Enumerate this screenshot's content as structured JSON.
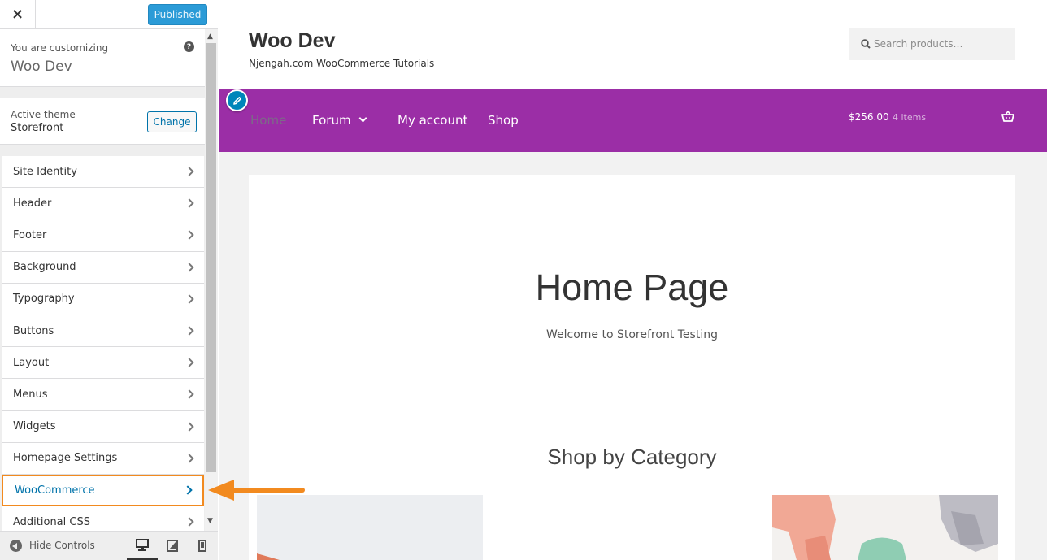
{
  "sidebar": {
    "close_label": "×",
    "publish_label": "Published",
    "info_label": "You are customizing",
    "site_name": "Woo Dev",
    "help_label": "?",
    "theme_label": "Active theme",
    "theme_name": "Storefront",
    "change_label": "Change",
    "items": [
      {
        "label": "Site Identity"
      },
      {
        "label": "Header"
      },
      {
        "label": "Footer"
      },
      {
        "label": "Background"
      },
      {
        "label": "Typography"
      },
      {
        "label": "Buttons"
      },
      {
        "label": "Layout"
      },
      {
        "label": "Menus"
      },
      {
        "label": "Widgets"
      },
      {
        "label": "Homepage Settings"
      },
      {
        "label": "WooCommerce"
      },
      {
        "label": "Additional CSS"
      }
    ],
    "hide_controls_label": "Hide Controls"
  },
  "preview": {
    "site_title": "Woo Dev",
    "tagline": "Njengah.com WooCommerce Tutorials",
    "search_placeholder": "Search products…",
    "nav": {
      "home": "Home",
      "forum": "Forum",
      "account": "My account",
      "shop": "Shop"
    },
    "cart_total": "$256.00",
    "cart_count": "4 items",
    "page_heading": "Home Page",
    "page_sub": "Welcome to Storefront Testing",
    "shop_heading": "Shop by Category"
  },
  "colors": {
    "nav_bg": "#9b2ea6",
    "accent_blue": "#0073aa",
    "highlight_orange": "#f28a1f",
    "publish_blue": "#2b9bd7"
  },
  "icons": [
    "close-icon",
    "help-icon",
    "chevron-right-icon",
    "search-icon",
    "pencil-icon",
    "basket-icon",
    "desktop-icon",
    "tablet-icon",
    "mobile-icon",
    "collapse-icon",
    "arrow-left-icon"
  ]
}
